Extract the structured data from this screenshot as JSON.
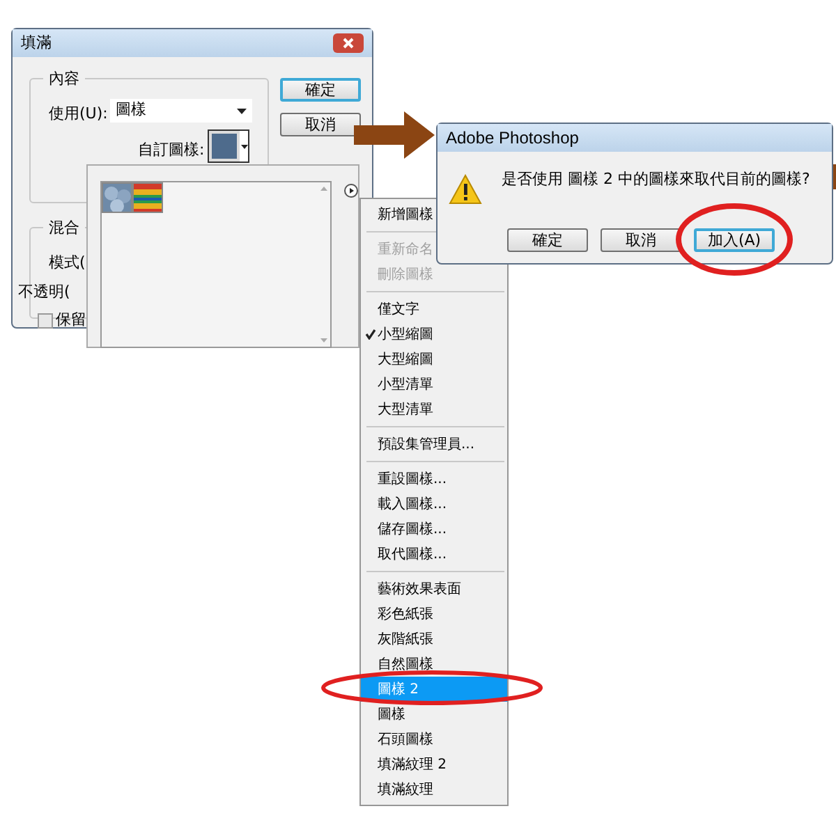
{
  "fill_dialog": {
    "title": "填滿",
    "content_group": {
      "title": "內容",
      "use_label": "使用(U):",
      "use_value": "圖樣",
      "custom_pattern_label": "自訂圖樣:"
    },
    "buttons": [
      {
        "label": "確定",
        "default": true
      },
      {
        "label": "取消",
        "default": false
      }
    ],
    "blending_group": {
      "title": "混合",
      "mode_label": "模式(",
      "opacity_label": "不透明(",
      "preserve": {
        "label": "保留",
        "checked": false
      }
    }
  },
  "pattern_picker": {
    "patterns": [
      {
        "kind": "bubbles"
      },
      {
        "kind": "rainbow"
      }
    ]
  },
  "menu": {
    "groups": [
      [
        {
          "label": "新增圖樣",
          "disabled": false,
          "checked": false,
          "selected": false
        }
      ],
      [
        {
          "label": "重新命名",
          "disabled": true,
          "checked": false,
          "selected": false
        },
        {
          "label": "刪除圖樣",
          "disabled": true,
          "checked": false,
          "selected": false
        }
      ],
      [
        {
          "label": "僅文字",
          "disabled": false,
          "checked": false,
          "selected": false
        },
        {
          "label": "小型縮圖",
          "disabled": false,
          "checked": true,
          "selected": false
        },
        {
          "label": "大型縮圖",
          "disabled": false,
          "checked": false,
          "selected": false
        },
        {
          "label": "小型清單",
          "disabled": false,
          "checked": false,
          "selected": false
        },
        {
          "label": "大型清單",
          "disabled": false,
          "checked": false,
          "selected": false
        }
      ],
      [
        {
          "label": "預設集管理員...",
          "disabled": false,
          "checked": false,
          "selected": false
        }
      ],
      [
        {
          "label": "重設圖樣...",
          "disabled": false,
          "checked": false,
          "selected": false
        },
        {
          "label": "載入圖樣...",
          "disabled": false,
          "checked": false,
          "selected": false
        },
        {
          "label": "儲存圖樣...",
          "disabled": false,
          "checked": false,
          "selected": false
        },
        {
          "label": "取代圖樣...",
          "disabled": false,
          "checked": false,
          "selected": false
        }
      ],
      [
        {
          "label": "藝術效果表面",
          "disabled": false,
          "checked": false,
          "selected": false
        },
        {
          "label": "彩色紙張",
          "disabled": false,
          "checked": false,
          "selected": false
        },
        {
          "label": "灰階紙張",
          "disabled": false,
          "checked": false,
          "selected": false
        },
        {
          "label": "自然圖樣",
          "disabled": false,
          "checked": false,
          "selected": false
        },
        {
          "label": "圖樣 2",
          "disabled": false,
          "checked": false,
          "selected": true
        },
        {
          "label": "圖樣",
          "disabled": false,
          "checked": false,
          "selected": false
        },
        {
          "label": "石頭圖樣",
          "disabled": false,
          "checked": false,
          "selected": false
        },
        {
          "label": "填滿紋理 2",
          "disabled": false,
          "checked": false,
          "selected": false
        },
        {
          "label": "填滿紋理",
          "disabled": false,
          "checked": false,
          "selected": false
        }
      ]
    ]
  },
  "alert": {
    "title": "Adobe Photoshop",
    "message": "是否使用 圖樣 2 中的圖樣來取代目前的圖樣?",
    "buttons": [
      {
        "label": "確定",
        "default": false
      },
      {
        "label": "取消",
        "default": false
      },
      {
        "label": "加入(A)",
        "default": true
      }
    ]
  }
}
